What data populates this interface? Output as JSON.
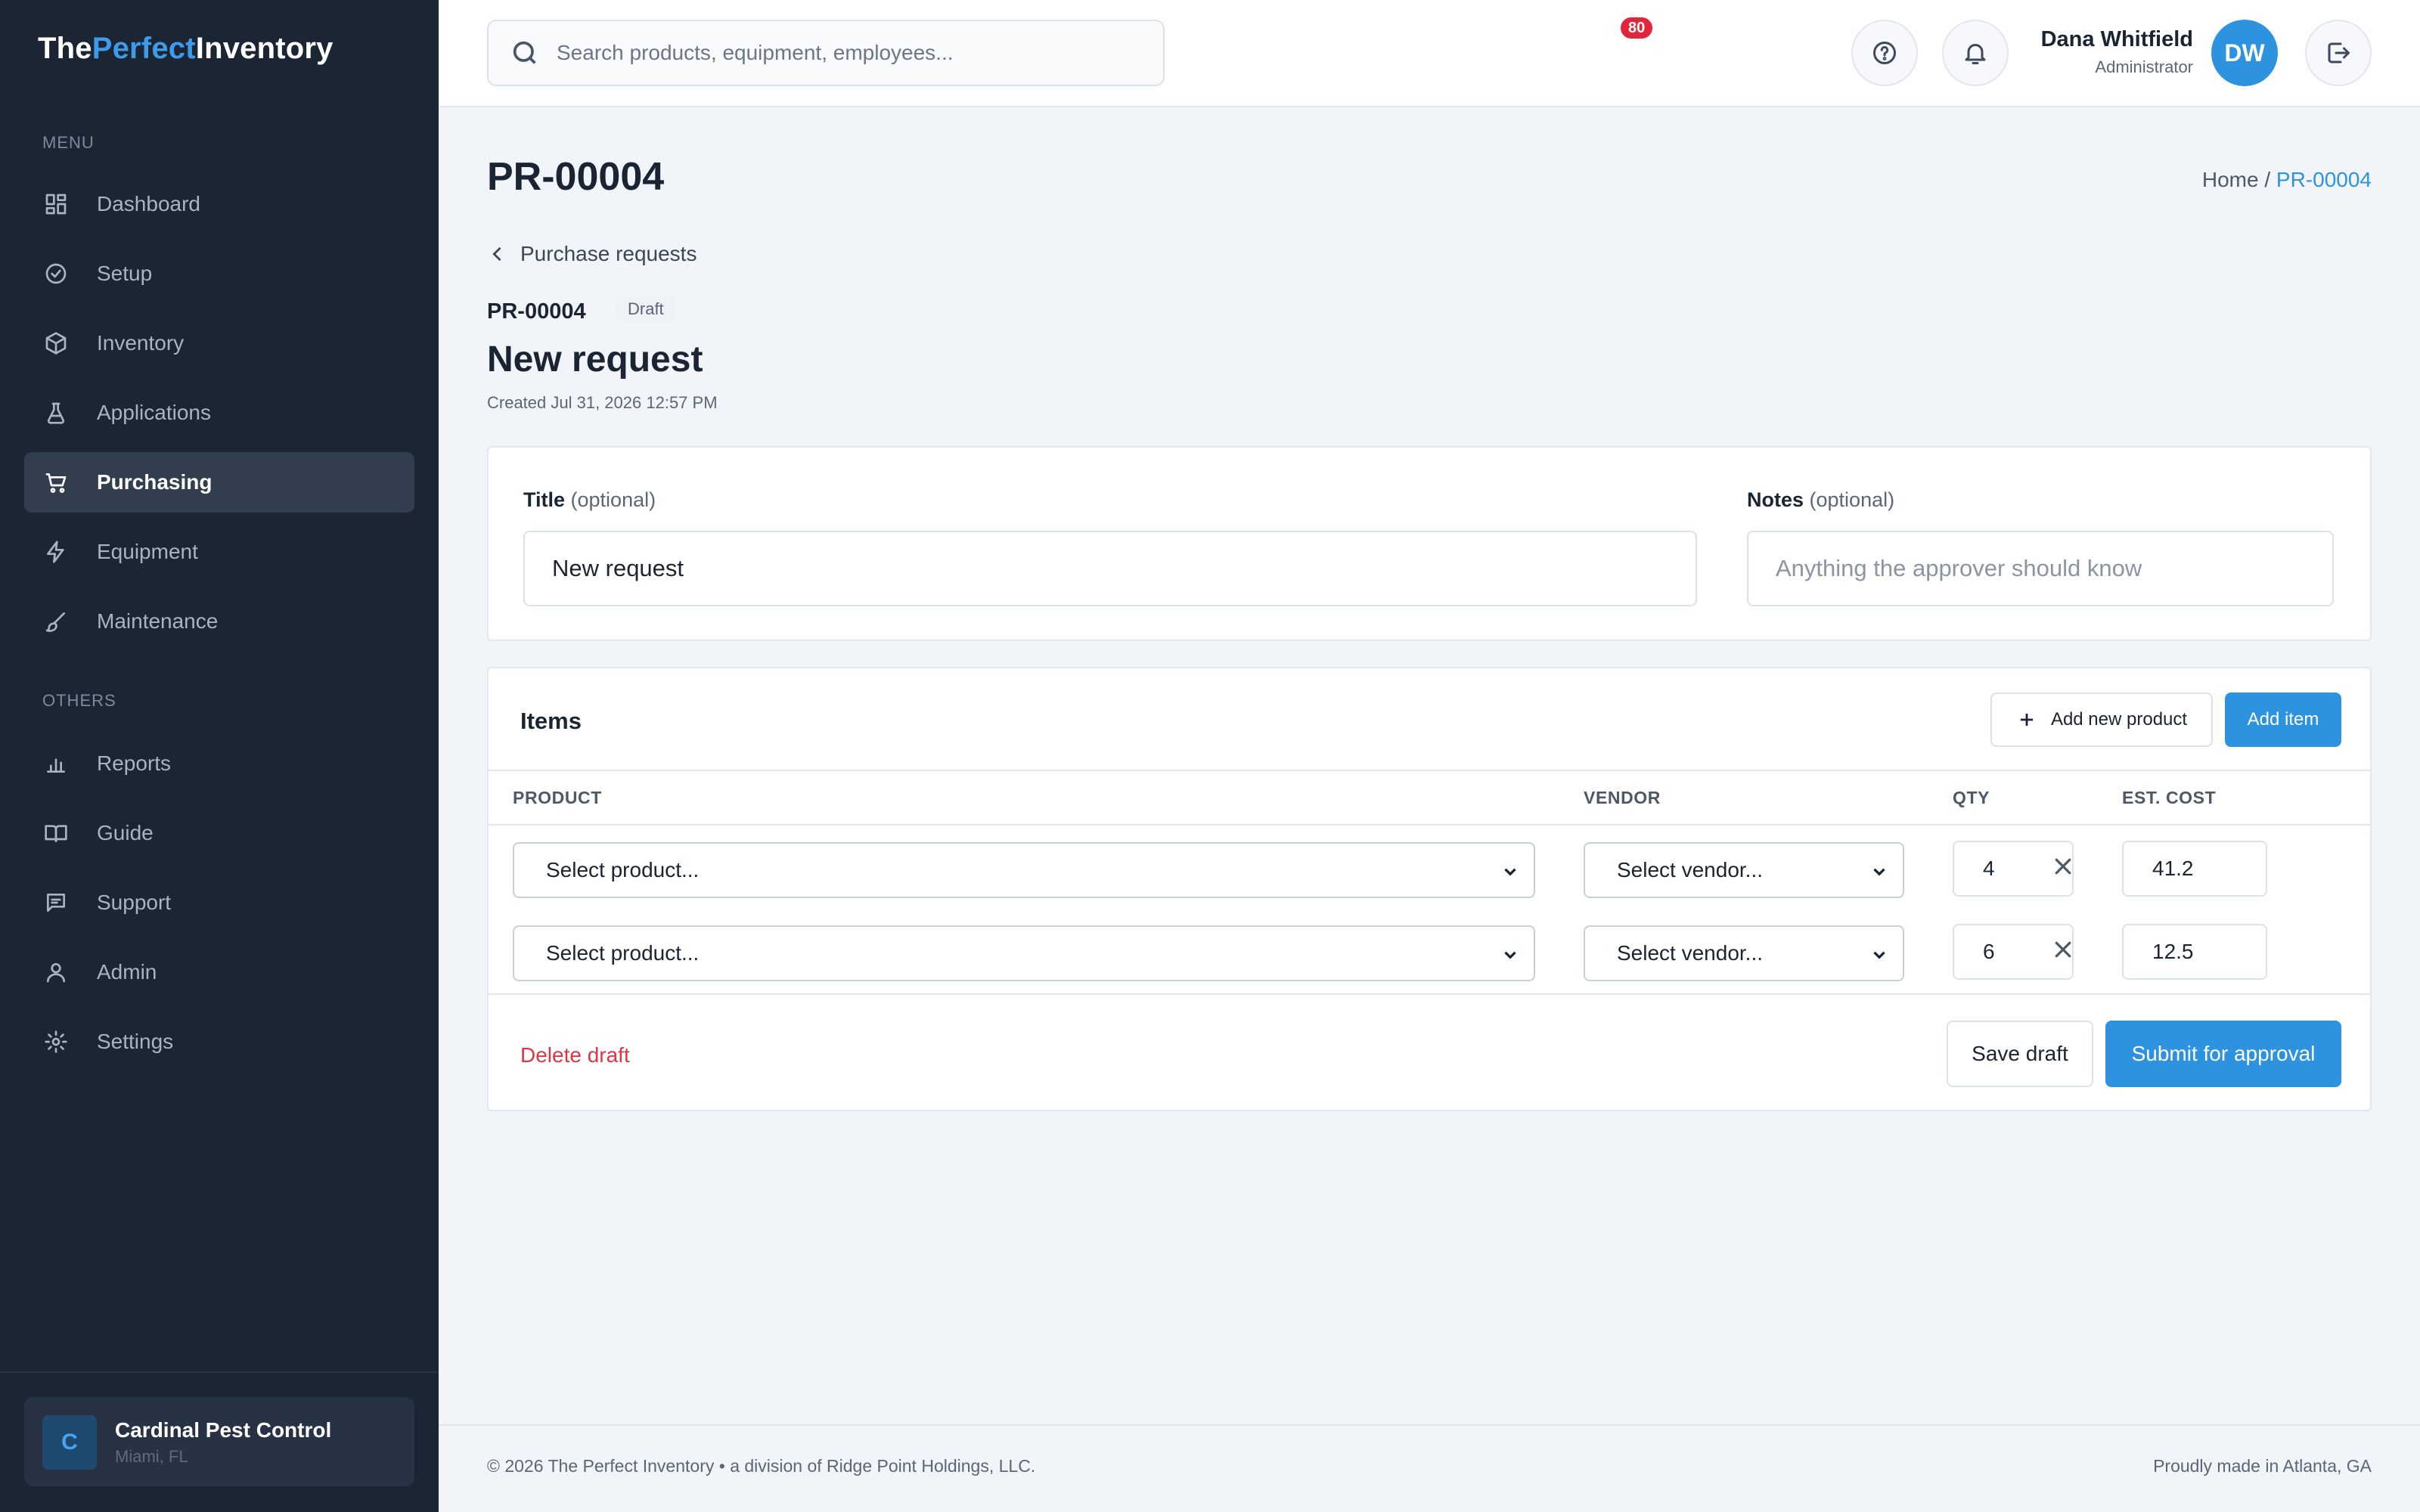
{
  "app": {
    "logo_part1": "The",
    "logo_part2": "Perfect",
    "logo_part3": "Inventory"
  },
  "sidebar": {
    "menu_label": "MENU",
    "others_label": "OTHERS",
    "menu_items": [
      {
        "label": "Dashboard",
        "icon": "dashboard-icon"
      },
      {
        "label": "Setup",
        "icon": "check-circle-icon"
      },
      {
        "label": "Inventory",
        "icon": "box-icon"
      },
      {
        "label": "Applications",
        "icon": "flask-icon"
      },
      {
        "label": "Purchasing",
        "icon": "cart-icon",
        "active": true
      },
      {
        "label": "Equipment",
        "icon": "bolt-icon"
      },
      {
        "label": "Maintenance",
        "icon": "brush-icon"
      }
    ],
    "other_items": [
      {
        "label": "Reports",
        "icon": "bar-chart-icon"
      },
      {
        "label": "Guide",
        "icon": "book-icon"
      },
      {
        "label": "Support",
        "icon": "message-icon"
      },
      {
        "label": "Admin",
        "icon": "user-icon"
      },
      {
        "label": "Settings",
        "icon": "gear-icon"
      }
    ],
    "org": {
      "initial": "C",
      "name": "Cardinal Pest Control",
      "location": "Miami, FL"
    }
  },
  "header": {
    "search_placeholder": "Search products, equipment, employees...",
    "notification_count": "80",
    "user_name": "Dana Whitfield",
    "user_role": "Administrator",
    "user_initials": "DW"
  },
  "page": {
    "title": "PR-00004",
    "breadcrumb_home": "Home",
    "breadcrumb_sep": "/",
    "breadcrumb_current": "PR-00004",
    "back_label": "Purchase requests",
    "request_id": "PR-00004",
    "status": "Draft",
    "request_title": "New request",
    "created": "Created Jul 31, 2026 12:57 PM"
  },
  "form": {
    "title_label": "Title",
    "title_optional": "(optional)",
    "title_value": "New request",
    "notes_label": "Notes",
    "notes_optional": "(optional)",
    "notes_placeholder": "Anything the approver should know"
  },
  "items": {
    "heading": "Items",
    "add_new_product_label": "Add new product",
    "add_item_label": "Add item",
    "columns": [
      "PRODUCT",
      "VENDOR",
      "QTY",
      "EST. COST"
    ],
    "rows": [
      {
        "product": "Select product...",
        "vendor": "Select vendor...",
        "qty": "4",
        "cost": "41.2"
      },
      {
        "product": "Select product...",
        "vendor": "Select vendor...",
        "qty": "6",
        "cost": "12.5"
      }
    ],
    "delete_label": "Delete draft",
    "save_label": "Save draft",
    "submit_label": "Submit for approval"
  },
  "footer": {
    "left": "© 2026 The Perfect Inventory • a division of Ridge Point Holdings, LLC.",
    "right": "Proudly made in Atlanta, GA"
  },
  "colors": {
    "accent": "#2d93e0",
    "sidebar_bg": "#1b2533",
    "danger": "#d93847",
    "badge": "#e0263a"
  }
}
